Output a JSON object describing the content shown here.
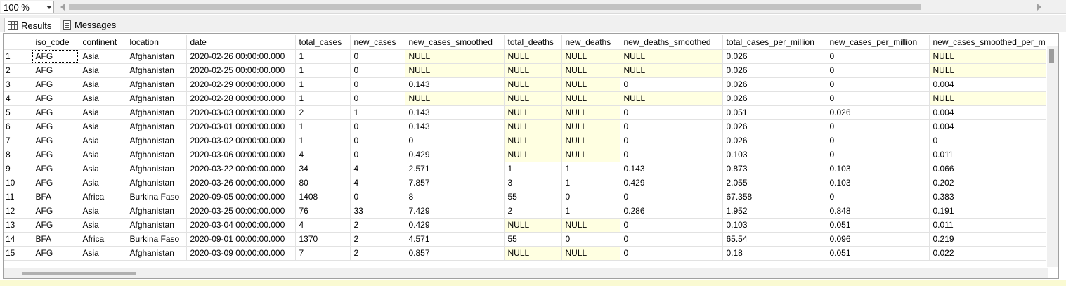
{
  "zoom": {
    "value": "100 %"
  },
  "tabs": {
    "results": "Results",
    "messages": "Messages"
  },
  "columns": [
    "iso_code",
    "continent",
    "location",
    "date",
    "total_cases",
    "new_cases",
    "new_cases_smoothed",
    "total_deaths",
    "new_deaths",
    "new_deaths_smoothed",
    "total_cases_per_million",
    "new_cases_per_million",
    "new_cases_smoothed_per_m"
  ],
  "rows": [
    [
      "1",
      "AFG",
      "Asia",
      "Afghanistan",
      "2020-02-26 00:00:00.000",
      "1",
      "0",
      "NULL",
      "NULL",
      "NULL",
      "NULL",
      "0.026",
      "0",
      "NULL"
    ],
    [
      "2",
      "AFG",
      "Asia",
      "Afghanistan",
      "2020-02-25 00:00:00.000",
      "1",
      "0",
      "NULL",
      "NULL",
      "NULL",
      "NULL",
      "0.026",
      "0",
      "NULL"
    ],
    [
      "3",
      "AFG",
      "Asia",
      "Afghanistan",
      "2020-02-29 00:00:00.000",
      "1",
      "0",
      "0.143",
      "NULL",
      "NULL",
      "0",
      "0.026",
      "0",
      "0.004"
    ],
    [
      "4",
      "AFG",
      "Asia",
      "Afghanistan",
      "2020-02-28 00:00:00.000",
      "1",
      "0",
      "NULL",
      "NULL",
      "NULL",
      "NULL",
      "0.026",
      "0",
      "NULL"
    ],
    [
      "5",
      "AFG",
      "Asia",
      "Afghanistan",
      "2020-03-03 00:00:00.000",
      "2",
      "1",
      "0.143",
      "NULL",
      "NULL",
      "0",
      "0.051",
      "0.026",
      "0.004"
    ],
    [
      "6",
      "AFG",
      "Asia",
      "Afghanistan",
      "2020-03-01 00:00:00.000",
      "1",
      "0",
      "0.143",
      "NULL",
      "NULL",
      "0",
      "0.026",
      "0",
      "0.004"
    ],
    [
      "7",
      "AFG",
      "Asia",
      "Afghanistan",
      "2020-03-02 00:00:00.000",
      "1",
      "0",
      "0",
      "NULL",
      "NULL",
      "0",
      "0.026",
      "0",
      "0"
    ],
    [
      "8",
      "AFG",
      "Asia",
      "Afghanistan",
      "2020-03-06 00:00:00.000",
      "4",
      "0",
      "0.429",
      "NULL",
      "NULL",
      "0",
      "0.103",
      "0",
      "0.011"
    ],
    [
      "9",
      "AFG",
      "Asia",
      "Afghanistan",
      "2020-03-22 00:00:00.000",
      "34",
      "4",
      "2.571",
      "1",
      "1",
      "0.143",
      "0.873",
      "0.103",
      "0.066"
    ],
    [
      "10",
      "AFG",
      "Asia",
      "Afghanistan",
      "2020-03-26 00:00:00.000",
      "80",
      "4",
      "7.857",
      "3",
      "1",
      "0.429",
      "2.055",
      "0.103",
      "0.202"
    ],
    [
      "11",
      "BFA",
      "Africa",
      "Burkina Faso",
      "2020-09-05 00:00:00.000",
      "1408",
      "0",
      "8",
      "55",
      "0",
      "0",
      "67.358",
      "0",
      "0.383"
    ],
    [
      "12",
      "AFG",
      "Asia",
      "Afghanistan",
      "2020-03-25 00:00:00.000",
      "76",
      "33",
      "7.429",
      "2",
      "1",
      "0.286",
      "1.952",
      "0.848",
      "0.191"
    ],
    [
      "13",
      "AFG",
      "Asia",
      "Afghanistan",
      "2020-03-04 00:00:00.000",
      "4",
      "2",
      "0.429",
      "NULL",
      "NULL",
      "0",
      "0.103",
      "0.051",
      "0.011"
    ],
    [
      "14",
      "BFA",
      "Africa",
      "Burkina Faso",
      "2020-09-01 00:00:00.000",
      "1370",
      "2",
      "4.571",
      "55",
      "0",
      "0",
      "65.54",
      "0.096",
      "0.219"
    ],
    [
      "15",
      "AFG",
      "Asia",
      "Afghanistan",
      "2020-03-09 00:00:00.000",
      "7",
      "2",
      "0.857",
      "NULL",
      "NULL",
      "0",
      "0.18",
      "0.051",
      "0.022"
    ]
  ],
  "colors": {
    "null_cell": "#ffffe1",
    "grid_line": "#e2e2e2"
  }
}
